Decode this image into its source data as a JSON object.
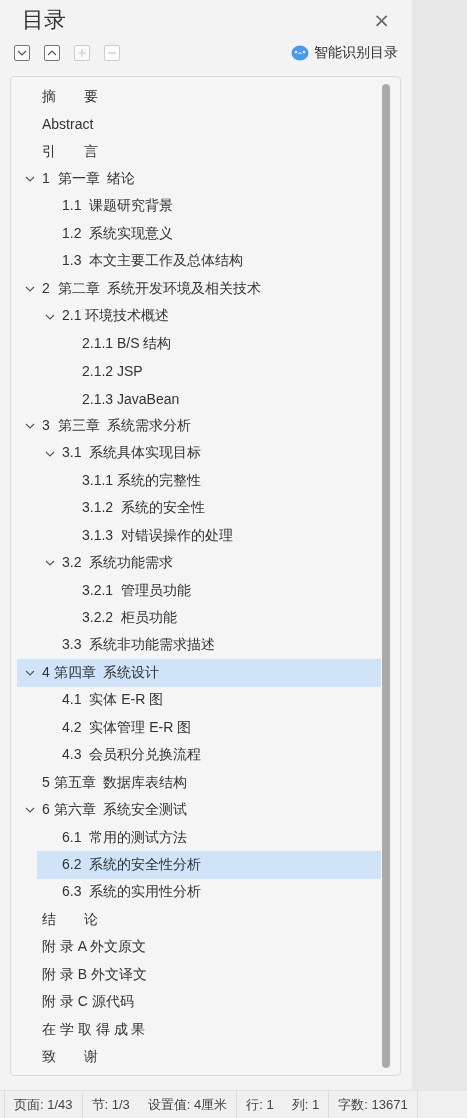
{
  "panel": {
    "title": "目录",
    "close": "×"
  },
  "toolbar": {
    "buttons": [
      {
        "kind": "down",
        "disabled": false
      },
      {
        "kind": "up",
        "disabled": false
      },
      {
        "kind": "plus",
        "disabled": true
      },
      {
        "kind": "minus",
        "disabled": true
      }
    ],
    "smart_button": "智能识别目录"
  },
  "toc": {
    "items": [
      {
        "label": "摘　　要",
        "selected": false
      },
      {
        "label": "Abstract",
        "selected": false
      },
      {
        "label": "引　　言",
        "selected": false
      },
      {
        "label": "1  第一章  绪论",
        "selected": false,
        "expanded": true,
        "children": [
          {
            "label": "1.1  课题研究背景",
            "selected": false
          },
          {
            "label": "1.2  系统实现意义",
            "selected": false
          },
          {
            "label": "1.3  本文主要工作及总体结构",
            "selected": false
          }
        ]
      },
      {
        "label": "2  第二章  系统开发环境及相关技术",
        "selected": false,
        "expanded": true,
        "children": [
          {
            "label": "2.1 环境技术概述",
            "selected": false,
            "expanded": true,
            "children": [
              {
                "label": "2.1.1 B/S 结构",
                "selected": false
              },
              {
                "label": "2.1.2 JSP",
                "selected": false
              },
              {
                "label": "2.1.3 JavaBean",
                "selected": false
              }
            ]
          }
        ]
      },
      {
        "label": "3  第三章  系统需求分析",
        "selected": false,
        "expanded": true,
        "children": [
          {
            "label": "3.1  系统具体实现目标",
            "selected": false,
            "expanded": true,
            "children": [
              {
                "label": "3.1.1 系统的完整性",
                "selected": false
              },
              {
                "label": "3.1.2  系统的安全性",
                "selected": false
              },
              {
                "label": "3.1.3  对错误操作的处理",
                "selected": false
              }
            ]
          },
          {
            "label": "3.2  系统功能需求",
            "selected": false,
            "expanded": true,
            "children": [
              {
                "label": "3.2.1  管理员功能",
                "selected": false
              },
              {
                "label": "3.2.2  柜员功能",
                "selected": false
              }
            ]
          },
          {
            "label": "3.3  系统非功能需求描述",
            "selected": false
          }
        ]
      },
      {
        "label": "4 第四章  系统设计",
        "selected": true,
        "expanded": true,
        "children": [
          {
            "label": "4.1  实体 E-R 图",
            "selected": false
          },
          {
            "label": "4.2  实体管理 E-R 图",
            "selected": false
          },
          {
            "label": "4.3  会员积分兑换流程",
            "selected": false
          }
        ]
      },
      {
        "label": "5 第五章  数据库表结构",
        "selected": false
      },
      {
        "label": "6 第六章  系统安全测试",
        "selected": false,
        "expanded": true,
        "children": [
          {
            "label": "6.1  常用的测试方法",
            "selected": false
          },
          {
            "label": "6.2  系统的安全性分析",
            "selected": true
          },
          {
            "label": "6.3  系统的实用性分析",
            "selected": false
          }
        ]
      },
      {
        "label": "结　　论",
        "selected": false
      },
      {
        "label": "附 录 A 外文原文",
        "selected": false
      },
      {
        "label": "附 录 B 外文译文",
        "selected": false
      },
      {
        "label": "附 录 C 源代码",
        "selected": false
      },
      {
        "label": "在 学 取 得 成 果",
        "selected": false
      },
      {
        "label": "致　　谢",
        "selected": false
      }
    ]
  },
  "status_bar": {
    "groups": [
      [
        "页面: 1/43"
      ],
      [
        "节: 1/3",
        "设置值: 4厘米"
      ],
      [
        "行: 1",
        "列: 1"
      ],
      [
        "字数: 13671"
      ]
    ]
  }
}
